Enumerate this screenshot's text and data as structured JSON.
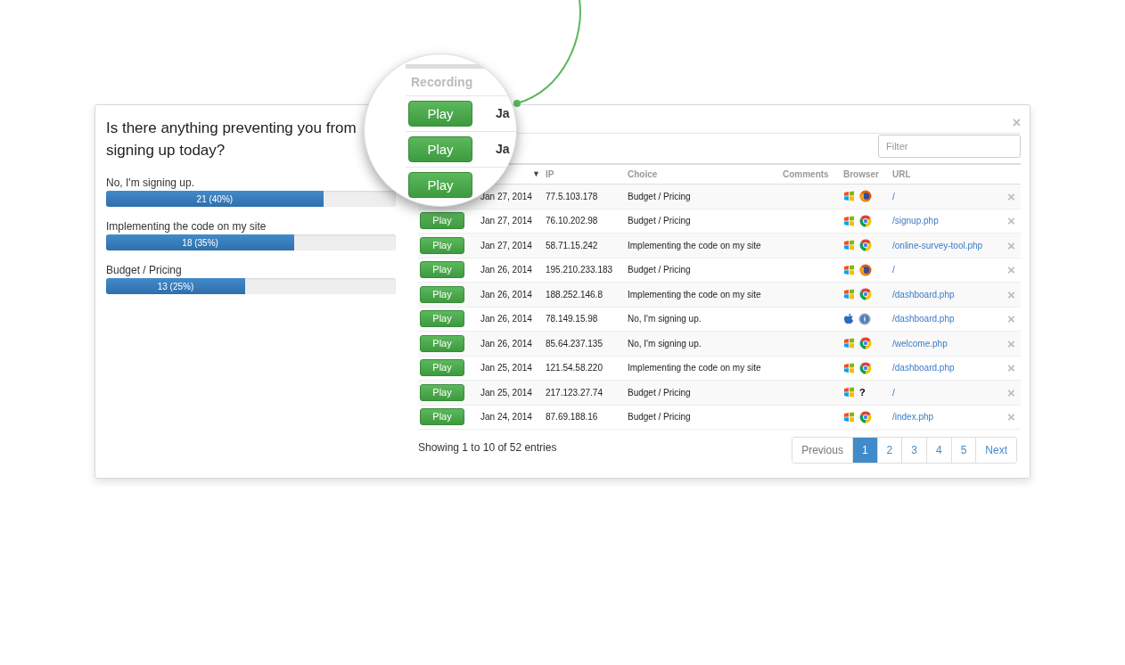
{
  "poll": {
    "question": "Is there anything preventing you from signing up today?",
    "close": "×",
    "answers": [
      {
        "label": "No, I'm signing up.",
        "count": "21 (40%)",
        "level": 0.75
      },
      {
        "label": "Implementing the code on my site",
        "count": "18 (35%)",
        "level": 0.65
      },
      {
        "label": "Budget / Pricing",
        "count": "13 (25%)",
        "level": 0.48
      }
    ]
  },
  "filter": {
    "placeholder": "Filter"
  },
  "table": {
    "sort_indicator": "▼",
    "columns": [
      "IP",
      "Choice",
      "Comments",
      "Browser",
      "URL"
    ],
    "rows": [
      {
        "date": "Jan 27, 2014",
        "ip": "77.5.103.178",
        "choice": "Budget / Pricing",
        "os": {
          "kind": "windows"
        },
        "browser": {
          "kind": "firefox"
        },
        "url": "/",
        "remove": "×"
      },
      {
        "play": "Play",
        "date": "Jan 27, 2014",
        "ip": "76.10.202.98",
        "choice": "Budget / Pricing",
        "os": {
          "kind": "windows"
        },
        "browser": {
          "kind": "chrome"
        },
        "url": "/signup.php",
        "remove": "×"
      },
      {
        "play": "Play",
        "date": "Jan 27, 2014",
        "ip": "58.71.15.242",
        "choice": "Implementing the code on my site",
        "os": {
          "kind": "windows"
        },
        "browser": {
          "kind": "chrome"
        },
        "url": "/online-survey-tool.php",
        "remove": "×"
      },
      {
        "play": "Play",
        "date": "Jan 26, 2014",
        "ip": "195.210.233.183",
        "choice": "Budget / Pricing",
        "os": {
          "kind": "windows"
        },
        "browser": {
          "kind": "firefox"
        },
        "url": "/",
        "remove": "×"
      },
      {
        "play": "Play",
        "date": "Jan 26, 2014",
        "ip": "188.252.146.8",
        "choice": "Implementing the code on my site",
        "os": {
          "kind": "windows"
        },
        "browser": {
          "kind": "chrome"
        },
        "url": "/dashboard.php",
        "remove": "×"
      },
      {
        "play": "Play",
        "date": "Jan 26, 2014",
        "ip": "78.149.15.98",
        "choice": "No, I'm signing up.",
        "os": {
          "kind": "apple"
        },
        "browser": {
          "kind": "safari"
        },
        "url": "/dashboard.php",
        "remove": "×"
      },
      {
        "play": "Play",
        "date": "Jan 26, 2014",
        "ip": "85.64.237.135",
        "choice": "No, I'm signing up.",
        "os": {
          "kind": "windows"
        },
        "browser": {
          "kind": "chrome"
        },
        "url": "/welcome.php",
        "remove": "×"
      },
      {
        "play": "Play",
        "date": "Jan 25, 2014",
        "ip": "121.54.58.220",
        "choice": "Implementing the code on my site",
        "os": {
          "kind": "windows"
        },
        "browser": {
          "kind": "chrome"
        },
        "url": "/dashboard.php",
        "remove": "×"
      },
      {
        "play": "Play",
        "date": "Jan 25, 2014",
        "ip": "217.123.27.74",
        "choice": "Budget / Pricing",
        "os": {
          "kind": "windows"
        },
        "browser": {
          "kind": "unknown",
          "label": "?"
        },
        "url": "/",
        "remove": "×"
      },
      {
        "play": "Play",
        "date": "Jan 24, 2014",
        "ip": "87.69.188.16",
        "choice": "Budget / Pricing",
        "os": {
          "kind": "windows"
        },
        "browser": {
          "kind": "chrome"
        },
        "url": "/index.php",
        "remove": "×"
      }
    ]
  },
  "summary": "Showing 1 to 10 of 52 entries",
  "pagination": [
    {
      "label": "Previous",
      "selected": false
    },
    {
      "label": "1",
      "selected": true
    },
    {
      "label": "2",
      "selected": false
    },
    {
      "label": "3",
      "selected": false
    },
    {
      "label": "4",
      "selected": false
    },
    {
      "label": "5",
      "selected": false
    },
    {
      "label": "Next",
      "selected": false
    }
  ],
  "magnifier": {
    "header": "Recording",
    "rows": [
      {
        "play": "Play",
        "date": "Ja"
      },
      {
        "play": "Play",
        "date": "Ja"
      },
      {
        "play": "Play"
      }
    ]
  }
}
